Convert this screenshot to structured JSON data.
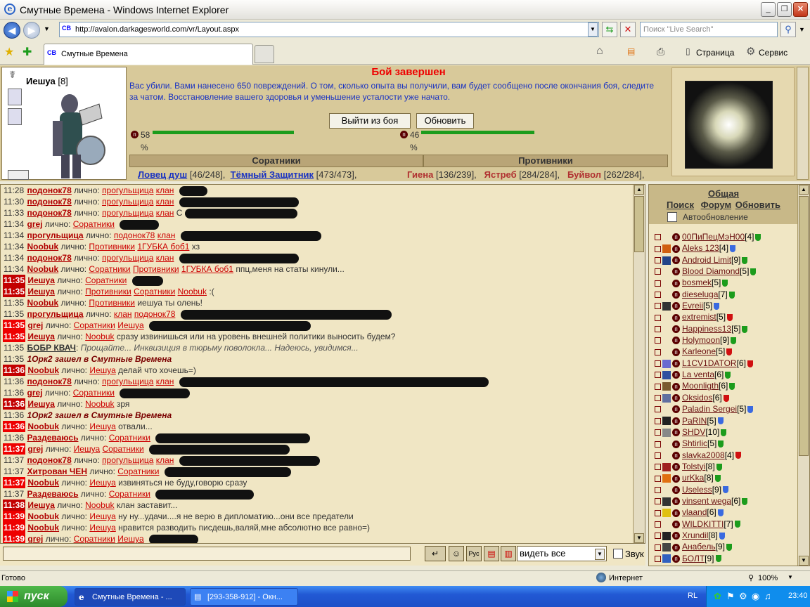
{
  "window": {
    "title": "Смутные Времена - Windows Internet Explorer"
  },
  "address": {
    "url": "http://avalon.darkagesworld.com/vr/Layout.aspx",
    "search_placeholder": "Поиск \"Live Search\""
  },
  "tab": {
    "label": "Смутные Времена"
  },
  "toolbar": {
    "page_label": "Страница",
    "service_label": "Сервис"
  },
  "character": {
    "name": "Иешуа",
    "level": "[8]"
  },
  "battle": {
    "header": "Бой завершен",
    "message": "Вас убили. Вами нанесено 650 повреждений. О том, сколько опыта вы получили, вам будет сообщено после окончания боя, следите за чатом. Восстановление вашего здоровья и уменьшение усталости уже начато.",
    "exit_button": "Выйти из боя",
    "refresh_button": "Обновить",
    "left_hp": "58",
    "left_pct": "%",
    "left_hp_fraction": 0.58,
    "right_hp": "46",
    "right_pct": "%",
    "right_hp_fraction": 0.46,
    "allies_header": "Соратники",
    "enemies_header": "Противники",
    "allies": [
      {
        "name": "Ловец душ",
        "hp": " [46/248],"
      },
      {
        "name": "Тёмный Защитник",
        "hp": " [473/473],"
      }
    ],
    "enemies": [
      {
        "name": "Гиена",
        "hp": " [136/239],"
      },
      {
        "name": "Ястреб",
        "hp": " [284/284],"
      },
      {
        "name": "Буйвол",
        "hp": " [262/284],"
      }
    ]
  },
  "chat": {
    "lines": [
      {
        "t": "11:28",
        "n": "подонок78",
        "m": " лично: ",
        "l": [
          "прогульщица",
          "клан"
        ],
        "x": "",
        "s": 40
      },
      {
        "t": "11:30",
        "n": "подонок78",
        "m": " лично: ",
        "l": [
          "прогульщица",
          "клан"
        ],
        "x": "",
        "s": 170
      },
      {
        "t": "11:33",
        "n": "подонок78",
        "m": " лично: ",
        "l": [
          "прогульщица",
          "клан"
        ],
        "x": " С",
        "s": 160
      },
      {
        "t": "11:34",
        "n": "grej",
        "m": " лично: ",
        "l": [
          "Соратники"
        ],
        "x": "",
        "s": 56
      },
      {
        "t": "11:34",
        "n": "прогульщица",
        "m": " лично: ",
        "l": [
          "подонок78",
          "клан"
        ],
        "x": "",
        "s": 200
      },
      {
        "t": "11:34",
        "n": "Noobuk",
        "m": " лично: ",
        "l": [
          "Противники",
          "1ГУБКА боб1"
        ],
        "x": " хз",
        "s": 0
      },
      {
        "t": "11:34",
        "n": "подонок78",
        "m": " лично: ",
        "l": [
          "прогульщица",
          "клан"
        ],
        "x": "",
        "s": 170
      },
      {
        "t": "11:34",
        "n": "Noobuk",
        "m": " лично: ",
        "l": [
          "Соратники",
          "Противники",
          "1ГУБКА боб1"
        ],
        "x": " ппц,меня на статы кинули...",
        "s": 0
      },
      {
        "t": "11:35",
        "h": 1,
        "n": "Иешуа",
        "m": " лично: ",
        "l": [
          "Соратники"
        ],
        "x": "",
        "s": 44
      },
      {
        "t": "11:35",
        "h": 1,
        "n": "Иешуа",
        "m": " лично: ",
        "l": [
          "Противники",
          "Соратники",
          "Noobuk"
        ],
        "x": " :(",
        "s": 0
      },
      {
        "t": "11:35",
        "n": "Noobuk",
        "m": " лично: ",
        "l": [
          "Противники"
        ],
        "x": " иешуа ты олень!",
        "s": 0
      },
      {
        "t": "11:35",
        "n": "прогульщица",
        "m": " лично: ",
        "l": [
          "клан",
          "подонок78"
        ],
        "x": "",
        "s": 300
      },
      {
        "t": "11:35",
        "h": 2,
        "n": "grej",
        "m": " лично: ",
        "l": [
          "Соратники",
          "Иешуа"
        ],
        "x": "",
        "s": 230
      },
      {
        "t": "11:35",
        "h": 2,
        "n": "Иешуа",
        "m": " лично: ",
        "l": [
          "Noobuk"
        ],
        "x": " сразу извинишься или на уровень внешней политики выносить будем?",
        "s": 0
      },
      {
        "t": "11:35",
        "b": 1,
        "n": "БОБР КВАЧ",
        "m": ": ",
        "l": [],
        "x": "Прощайте... Инквизиция в тюрьму поволокла... Надеюсь, увидимся...",
        "s": 0
      },
      {
        "t": "11:35",
        "y": 1,
        "x": "1Орк2 зашел в Смутные Времена",
        "l": [],
        "s": 0
      },
      {
        "t": "11:36",
        "h": 1,
        "n": "Noobuk",
        "m": " лично: ",
        "l": [
          "Иешуа"
        ],
        "x": " делай что хочешь=)",
        "s": 0
      },
      {
        "t": "11:36",
        "n": "подонок78",
        "m": " лично: ",
        "l": [
          "прогульщица",
          "клан"
        ],
        "x": "",
        "s": 440
      },
      {
        "t": "11:36",
        "n": "grej",
        "m": " лично: ",
        "l": [
          "Соратники"
        ],
        "x": "",
        "s": 100
      },
      {
        "t": "11:36",
        "h": 1,
        "n": "Иешуа",
        "m": " лично: ",
        "l": [
          "Noobuk"
        ],
        "x": " зря",
        "s": 0
      },
      {
        "t": "11:36",
        "y": 1,
        "x": "1Орк2 зашел в Смутные Времена",
        "l": [],
        "s": 0
      },
      {
        "t": "11:36",
        "h": 2,
        "n": "Noobuk",
        "m": " лично: ",
        "l": [
          "Иешуа"
        ],
        "x": " отвали...",
        "s": 0
      },
      {
        "t": "11:36",
        "n": "Раздеваюсь",
        "m": " лично: ",
        "l": [
          "Соратники"
        ],
        "x": "",
        "s": 220
      },
      {
        "t": "11:37",
        "h": 2,
        "n": "grej",
        "m": " лично: ",
        "l": [
          "Иешуа",
          "Соратники"
        ],
        "x": "",
        "s": 200
      },
      {
        "t": "11:37",
        "n": "подонок78",
        "m": " лично: ",
        "l": [
          "прогульщица",
          "клан"
        ],
        "x": "",
        "s": 200
      },
      {
        "t": "11:37",
        "n": "Хитрован ЧЕН",
        "m": " лично: ",
        "l": [
          "Соратники"
        ],
        "x": "",
        "s": 180
      },
      {
        "t": "11:37",
        "h": 2,
        "n": "Noobuk",
        "m": " лично: ",
        "l": [
          "Иешуа"
        ],
        "x": " извиняться не буду,говорю сразу",
        "s": 0
      },
      {
        "t": "11:37",
        "n": "Раздеваюсь",
        "m": " лично: ",
        "l": [
          "Соратники"
        ],
        "x": "",
        "s": 140
      },
      {
        "t": "11:38",
        "h": 1,
        "n": "Иешуа",
        "m": " лично: ",
        "l": [
          "Noobuk"
        ],
        "x": " клан заставит...",
        "s": 0
      },
      {
        "t": "11:39",
        "h": 2,
        "n": "Noobuk",
        "m": " лично: ",
        "l": [
          "Иешуа"
        ],
        "x": " ну ну...удачи....я не верю в дипломатию...они все предатели",
        "s": 0
      },
      {
        "t": "11:39",
        "h": 2,
        "n": "Noobuk",
        "m": " лично: ",
        "l": [
          "Иешуа"
        ],
        "x": " нравится разводить писдешь,валяй,мне абсолютно все равно=)",
        "s": 0
      },
      {
        "t": "11:39",
        "h": 2,
        "n": "grej",
        "m": " лично: ",
        "l": [
          "Соратники",
          "Иешуа"
        ],
        "x": "",
        "s": 70
      }
    ]
  },
  "chat_controls": {
    "filter_value": "видеть все",
    "sound_label": "Звук"
  },
  "users_panel": {
    "title": "Общая",
    "search": "Поиск",
    "forum": "Форум",
    "refresh": "Обновить",
    "autorefresh": "Автообновление",
    "users": [
      {
        "n": "00ПиПецМэН00",
        "l": "[4]",
        "c": "#1c9c1c",
        "i": ""
      },
      {
        "n": "Aleks 123",
        "l": "[4]",
        "c": "#3a6ae0",
        "i": "#d06010"
      },
      {
        "n": "Android Limit",
        "l": "[9]",
        "c": "#1c9c1c",
        "i": "#224488"
      },
      {
        "n": "Blood Diamond",
        "l": "[5]",
        "c": "#1c9c1c",
        "i": ""
      },
      {
        "n": "bosmek",
        "l": "[5]",
        "c": "#1c9c1c",
        "i": ""
      },
      {
        "n": "dieseluga",
        "l": "[7]",
        "c": "#1c9c1c",
        "i": ""
      },
      {
        "n": "Evreii",
        "l": "[5]",
        "c": "#3a6ae0",
        "i": "#333"
      },
      {
        "n": "extremist",
        "l": "[5]",
        "c": "#d01010",
        "i": ""
      },
      {
        "n": "Happiness13",
        "l": "[5]",
        "c": "#1c9c1c",
        "i": ""
      },
      {
        "n": "Holymoon",
        "l": "[9]",
        "c": "#1c9c1c",
        "i": ""
      },
      {
        "n": "Karleone",
        "l": "[5]",
        "c": "#d01010",
        "i": ""
      },
      {
        "n": "L1CV1DATOR",
        "l": "[6]",
        "c": "#d01010",
        "i": "#6a6ad0"
      },
      {
        "n": "La venta",
        "l": "[6]",
        "c": "#1c9c1c",
        "i": "#3050a0"
      },
      {
        "n": "Moonligth",
        "l": "[6]",
        "c": "#1c9c1c",
        "i": "#7a5a30"
      },
      {
        "n": "Oksidos",
        "l": "[6]",
        "c": "#d01010",
        "i": "#6070a0"
      },
      {
        "n": "Paladin Sergei",
        "l": "[5]",
        "c": "#3a6ae0",
        "i": ""
      },
      {
        "n": "PaRIN",
        "l": "[5]",
        "c": "#3a6ae0",
        "i": "#222"
      },
      {
        "n": "SHDV",
        "l": "[10]",
        "c": "#1c9c1c",
        "i": "#888"
      },
      {
        "n": "Shtirlic",
        "l": "[5]",
        "c": "#1c9c1c",
        "i": ""
      },
      {
        "n": "slavka2008",
        "l": "[4]",
        "c": "#d01010",
        "i": ""
      },
      {
        "n": "Tolstyi",
        "l": "[8]",
        "c": "#1c9c1c",
        "i": "#a02020"
      },
      {
        "n": "urKka",
        "l": "[8]",
        "c": "#1c9c1c",
        "i": "#e07010"
      },
      {
        "n": "Useless",
        "l": "[9]",
        "c": "#3a6ae0",
        "i": ""
      },
      {
        "n": "vinsent wega",
        "l": "[6]",
        "c": "#1c9c1c",
        "i": "#333"
      },
      {
        "n": "vlaand",
        "l": "[6]",
        "c": "#3a6ae0",
        "i": "#e0c010"
      },
      {
        "n": "WILDKITTI",
        "l": "[7]",
        "c": "#1c9c1c",
        "i": ""
      },
      {
        "n": "Xrundil",
        "l": "[8]",
        "c": "#3a6ae0",
        "i": "#222"
      },
      {
        "n": "Анабель",
        "l": "[9]",
        "c": "#1c9c1c",
        "i": "#444"
      },
      {
        "n": "БОЛТ",
        "l": "[9]",
        "c": "#1c9c1c",
        "i": "#3060c0"
      }
    ]
  },
  "status": {
    "left": "Готово",
    "zone": "Интернет",
    "zoom": "100%"
  },
  "taskbar": {
    "start": "пуск",
    "task1": "Смутные Времена - ...",
    "task2": "[293-358-912] - Окн...",
    "lang": "RL",
    "clock": "23:40"
  }
}
